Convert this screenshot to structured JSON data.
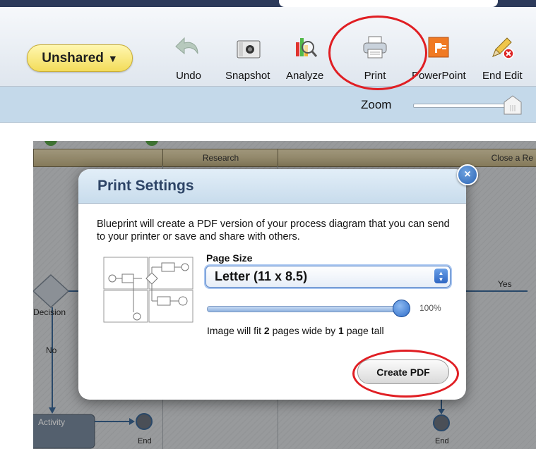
{
  "toolbar": {
    "share_button": {
      "label": "Unshared",
      "caret": "▼"
    },
    "tools": [
      {
        "label": "Undo",
        "icon": "undo-icon"
      },
      {
        "label": "Snapshot",
        "icon": "camera-icon"
      },
      {
        "label": "Analyze",
        "icon": "analyze-icon"
      },
      {
        "label": "Print",
        "icon": "printer-icon"
      },
      {
        "label": "PowerPoint",
        "icon": "powerpoint-icon"
      },
      {
        "label": "End Edit",
        "icon": "pencil-icon"
      }
    ]
  },
  "zoom": {
    "label": "Zoom",
    "level": 1.0
  },
  "diagram": {
    "lanes": [
      "Research",
      "Close a Re"
    ],
    "labels": {
      "decision": "Decision",
      "no": "No",
      "yes": "Yes",
      "activity": "Activity",
      "end1": "End",
      "end2": "End"
    }
  },
  "modal": {
    "title": "Print Settings",
    "close_glyph": "×",
    "description": "Blueprint will create a PDF version of your process diagram that you can send to your printer or save and share with others.",
    "page_size_label": "Page Size",
    "page_size_value": "Letter (11 x 8.5)",
    "scale_value": "100%",
    "fit": {
      "prefix": "Image will fit ",
      "wide": "2",
      "middle": " pages wide by ",
      "tall": "1",
      "suffix": " page tall"
    },
    "create_button": "Create PDF"
  },
  "colors": {
    "annotation_red": "#e01e23",
    "title_blue": "#2d4466",
    "unshared_yellow": "#f3dc5a",
    "toolbar_dark": "#2c3a5a"
  }
}
